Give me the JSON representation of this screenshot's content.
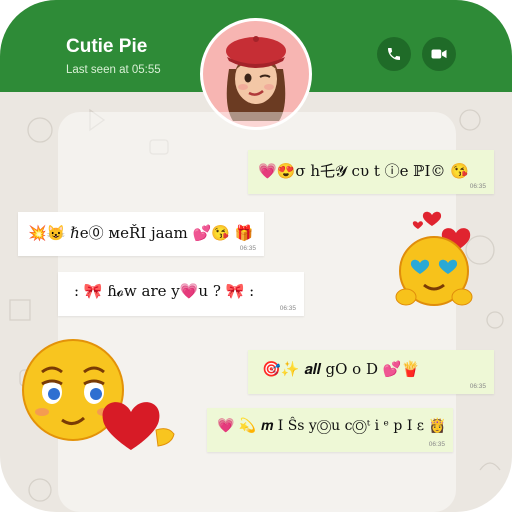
{
  "header": {
    "contact_name": "Cutie Pie",
    "last_seen": "Last seen at 05:55",
    "icons": [
      "phone-icon",
      "video-icon"
    ],
    "color": "#2e8b37"
  },
  "messages": [
    {
      "text": "💗😍σ һ乇𝓨 cυ t ⓘe ℙI© 😘",
      "time": "06:35",
      "side": "out"
    },
    {
      "text": "💥😺 ℏe⓪ мeŘI jaam 💕😘 🎁",
      "time": "06:35",
      "side": "in"
    },
    {
      "text": ": 🎀  ɦ𝓸w are y💗u ? 🎀 :",
      "time": "06:35",
      "side": "in"
    },
    {
      "text": "🎯✨  𝒂𝒍𝒍 gO o D 💕🍟",
      "time": "06:35",
      "side": "out"
    },
    {
      "text": "💗 💫 𝒎 I Ŝs yⓄu cⓄᵗ i ᵉ p I ε 👸",
      "time": "06:35",
      "side": "out"
    }
  ],
  "stickers": [
    "heart-eyes-emoji-sticker",
    "flirty-emoji-with-heart-sticker"
  ]
}
